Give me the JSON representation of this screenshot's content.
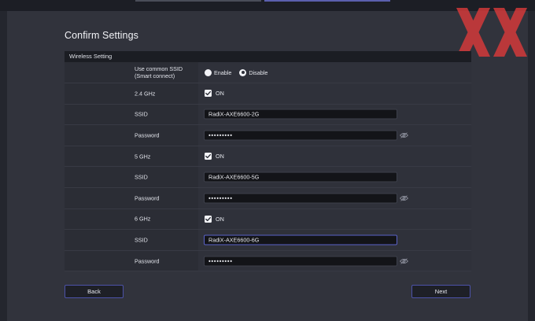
{
  "page": {
    "title": "Confirm Settings",
    "section_header": "Wireless Setting"
  },
  "rows": {
    "smart_connect": {
      "label": "Use common SSID\n(Smart connect)",
      "options": [
        "Enable",
        "Disable"
      ],
      "selected": "Disable"
    },
    "band_24": {
      "label": "2.4 GHz",
      "checkbox_label": "ON",
      "checked": true
    },
    "ssid_24": {
      "label": "SSID",
      "value": "RadiX-AXE6600-2G"
    },
    "pw_24": {
      "label": "Password",
      "value": "•••••••••"
    },
    "band_5": {
      "label": "5 GHz",
      "checkbox_label": "ON",
      "checked": true
    },
    "ssid_5": {
      "label": "SSID",
      "value": "RadiX-AXE6600-5G"
    },
    "pw_5": {
      "label": "Password",
      "value": "•••••••••"
    },
    "band_6": {
      "label": "6 GHz",
      "checkbox_label": "ON",
      "checked": true
    },
    "ssid_6": {
      "label": "SSID",
      "value": "RadiX-AXE6600-6G"
    },
    "pw_6": {
      "label": "Password",
      "value": "•••••••••"
    }
  },
  "buttons": {
    "back": "Back",
    "next": "Next"
  },
  "icons": {
    "password_toggle": "eye-icon",
    "checkbox": "checkmark-icon",
    "watermark": "xx-logo"
  },
  "colors": {
    "background": "#24262e",
    "panel": "#31333c",
    "accent": "#5a62c8",
    "watermark": "#d23a3a"
  }
}
